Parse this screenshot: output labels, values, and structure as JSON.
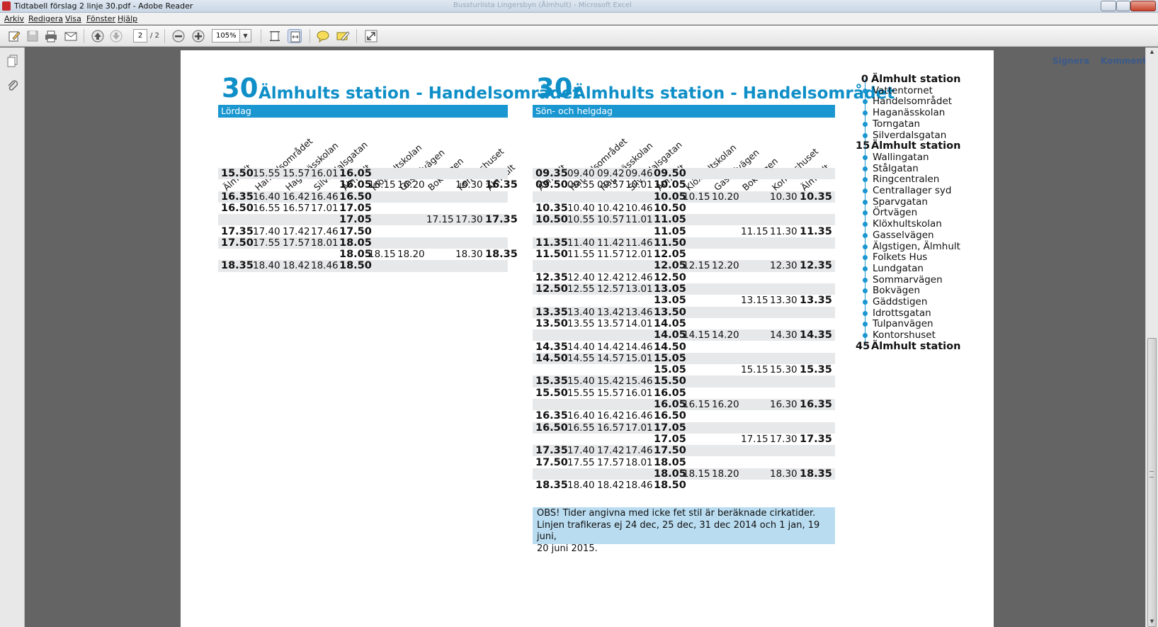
{
  "window": {
    "title": "Tidtabell förslag 2 linje 30.pdf - Adobe Reader",
    "background_title": "Bussturlista Lingersbyn (Ålmhult) - Microsoft Excel"
  },
  "menu": [
    "Arkiv",
    "Redigera",
    "Visa",
    "Fönster",
    "Hjälp"
  ],
  "toolbar": {
    "page_current": "2",
    "page_total": "/ 2",
    "zoom": "105%",
    "sign_label": "Signera",
    "comment_label": "Kommentar"
  },
  "colors": {
    "brand_blue": "#1a96d0",
    "title_blue": "#0f8fc8",
    "notice_bg": "#b9dcf0",
    "row_shade": "#e7e8ea"
  },
  "stops_header": [
    "Älmhult",
    "Handelsområdet",
    "Haganässkolan",
    "Silverdalsgatan",
    "Älmhult",
    "Klöxhultskolan",
    "Gasselvägen",
    "Bokvägen",
    "Kontorshuset",
    "Älmhult"
  ],
  "tables": [
    {
      "line": "30",
      "title": "Älmhults station - Handelsområdet",
      "day": "Lördag",
      "rows": [
        [
          "15.50",
          "15.55",
          "15.57",
          "16.01",
          "16.05",
          "",
          "",
          "",
          "",
          ""
        ],
        [
          "",
          "",
          "",
          "",
          "16.05",
          "16.15",
          "16.20",
          "",
          "16.30",
          "16.35"
        ],
        [
          "16.35",
          "16.40",
          "16.42",
          "16.46",
          "16.50",
          "",
          "",
          "",
          "",
          ""
        ],
        [
          "16.50",
          "16.55",
          "16.57",
          "17.01",
          "17.05",
          "",
          "",
          "",
          "",
          ""
        ],
        [
          "",
          "",
          "",
          "",
          "17.05",
          "",
          "",
          "17.15",
          "17.30",
          "17.35"
        ],
        [
          "17.35",
          "17.40",
          "17.42",
          "17.46",
          "17.50",
          "",
          "",
          "",
          "",
          ""
        ],
        [
          "17.50",
          "17.55",
          "17.57",
          "18.01",
          "18.05",
          "",
          "",
          "",
          "",
          ""
        ],
        [
          "",
          "",
          "",
          "",
          "18.05",
          "18.15",
          "18.20",
          "",
          "18.30",
          "18.35"
        ],
        [
          "18.35",
          "18.40",
          "18.42",
          "18.46",
          "18.50",
          "",
          "",
          "",
          "",
          ""
        ]
      ]
    },
    {
      "line": "30",
      "title": "Älmhults station - Handelsområdet",
      "day": "Sön- och helgdag",
      "rows": [
        [
          "09.35",
          "09.40",
          "09.42",
          "09.46",
          "09.50",
          "",
          "",
          "",
          "",
          ""
        ],
        [
          "09.50",
          "09.55",
          "09.57",
          "10.01",
          "10.05",
          "",
          "",
          "",
          "",
          ""
        ],
        [
          "",
          "",
          "",
          "",
          "10.05",
          "10.15",
          "10.20",
          "",
          "10.30",
          "10.35"
        ],
        [
          "10.35",
          "10.40",
          "10.42",
          "10.46",
          "10.50",
          "",
          "",
          "",
          "",
          ""
        ],
        [
          "10.50",
          "10.55",
          "10.57",
          "11.01",
          "11.05",
          "",
          "",
          "",
          "",
          ""
        ],
        [
          "",
          "",
          "",
          "",
          "11.05",
          "",
          "",
          "11.15",
          "11.30",
          "11.35"
        ],
        [
          "11.35",
          "11.40",
          "11.42",
          "11.46",
          "11.50",
          "",
          "",
          "",
          "",
          ""
        ],
        [
          "11.50",
          "11.55",
          "11.57",
          "12.01",
          "12.05",
          "",
          "",
          "",
          "",
          ""
        ],
        [
          "",
          "",
          "",
          "",
          "12.05",
          "12.15",
          "12.20",
          "",
          "12.30",
          "12.35"
        ],
        [
          "12.35",
          "12.40",
          "12.42",
          "12.46",
          "12.50",
          "",
          "",
          "",
          "",
          ""
        ],
        [
          "12.50",
          "12.55",
          "12.57",
          "13.01",
          "13.05",
          "",
          "",
          "",
          "",
          ""
        ],
        [
          "",
          "",
          "",
          "",
          "13.05",
          "",
          "",
          "13.15",
          "13.30",
          "13.35"
        ],
        [
          "13.35",
          "13.40",
          "13.42",
          "13.46",
          "13.50",
          "",
          "",
          "",
          "",
          ""
        ],
        [
          "13.50",
          "13.55",
          "13.57",
          "14.01",
          "14.05",
          "",
          "",
          "",
          "",
          ""
        ],
        [
          "",
          "",
          "",
          "",
          "14.05",
          "14.15",
          "14.20",
          "",
          "14.30",
          "14.35"
        ],
        [
          "14.35",
          "14.40",
          "14.42",
          "14.46",
          "14.50",
          "",
          "",
          "",
          "",
          ""
        ],
        [
          "14.50",
          "14.55",
          "14.57",
          "15.01",
          "15.05",
          "",
          "",
          "",
          "",
          ""
        ],
        [
          "",
          "",
          "",
          "",
          "15.05",
          "",
          "",
          "15.15",
          "15.30",
          "15.35"
        ],
        [
          "15.35",
          "15.40",
          "15.42",
          "15.46",
          "15.50",
          "",
          "",
          "",
          "",
          ""
        ],
        [
          "15.50",
          "15.55",
          "15.57",
          "16.01",
          "16.05",
          "",
          "",
          "",
          "",
          ""
        ],
        [
          "",
          "",
          "",
          "",
          "16.05",
          "16.15",
          "16.20",
          "",
          "16.30",
          "16.35"
        ],
        [
          "16.35",
          "16.40",
          "16.42",
          "16.46",
          "16.50",
          "",
          "",
          "",
          "",
          ""
        ],
        [
          "16.50",
          "16.55",
          "16.57",
          "17.01",
          "17.05",
          "",
          "",
          "",
          "",
          ""
        ],
        [
          "",
          "",
          "",
          "",
          "17.05",
          "",
          "",
          "17.15",
          "17.30",
          "17.35"
        ],
        [
          "17.35",
          "17.40",
          "17.42",
          "17.46",
          "17.50",
          "",
          "",
          "",
          "",
          ""
        ],
        [
          "17.50",
          "17.55",
          "17.57",
          "18.01",
          "18.05",
          "",
          "",
          "",
          "",
          ""
        ],
        [
          "",
          "",
          "",
          "",
          "18.05",
          "18.15",
          "18.20",
          "",
          "18.30",
          "18.35"
        ],
        [
          "18.35",
          "18.40",
          "18.42",
          "18.46",
          "18.50",
          "",
          "",
          "",
          "",
          ""
        ]
      ]
    }
  ],
  "notice": {
    "line1": "OBS! Tider angivna med icke fet stil är beräknade cirkatider.",
    "line2": "Linjen trafikeras ej 24 dec, 25 dec, 31 dec 2014 och 1 jan, 19 juni,",
    "line3": "20 juni 2015."
  },
  "route_stops": [
    {
      "min": "0",
      "name": "Älmhult station",
      "major": true
    },
    {
      "min": "",
      "name": "Vattentornet",
      "major": false
    },
    {
      "min": "",
      "name": "Handelsområdet",
      "major": false
    },
    {
      "min": "",
      "name": "Haganässkolan",
      "major": false
    },
    {
      "min": "",
      "name": "Torngatan",
      "major": false
    },
    {
      "min": "",
      "name": "Silverdalsgatan",
      "major": false
    },
    {
      "min": "15",
      "name": "Älmhult station",
      "major": true
    },
    {
      "min": "",
      "name": "Wallingatan",
      "major": false
    },
    {
      "min": "",
      "name": "Stålgatan",
      "major": false
    },
    {
      "min": "",
      "name": "Ringcentralen",
      "major": false
    },
    {
      "min": "",
      "name": "Centrallager syd",
      "major": false
    },
    {
      "min": "",
      "name": "Sparvgatan",
      "major": false
    },
    {
      "min": "",
      "name": "Örtvägen",
      "major": false
    },
    {
      "min": "",
      "name": "Klöxhultskolan",
      "major": false
    },
    {
      "min": "",
      "name": "Gasselvägen",
      "major": false
    },
    {
      "min": "",
      "name": "Älgstigen, Älmhult",
      "major": false
    },
    {
      "min": "",
      "name": "Folkets Hus",
      "major": false
    },
    {
      "min": "",
      "name": "Lundgatan",
      "major": false
    },
    {
      "min": "",
      "name": "Sommarvägen",
      "major": false
    },
    {
      "min": "",
      "name": "Bokvägen",
      "major": false
    },
    {
      "min": "",
      "name": "Gäddstigen",
      "major": false
    },
    {
      "min": "",
      "name": "Idrottsgatan",
      "major": false
    },
    {
      "min": "",
      "name": "Tulpanvägen",
      "major": false
    },
    {
      "min": "",
      "name": "Kontorshuset",
      "major": false
    },
    {
      "min": "45",
      "name": "Älmhult station",
      "major": true
    }
  ]
}
